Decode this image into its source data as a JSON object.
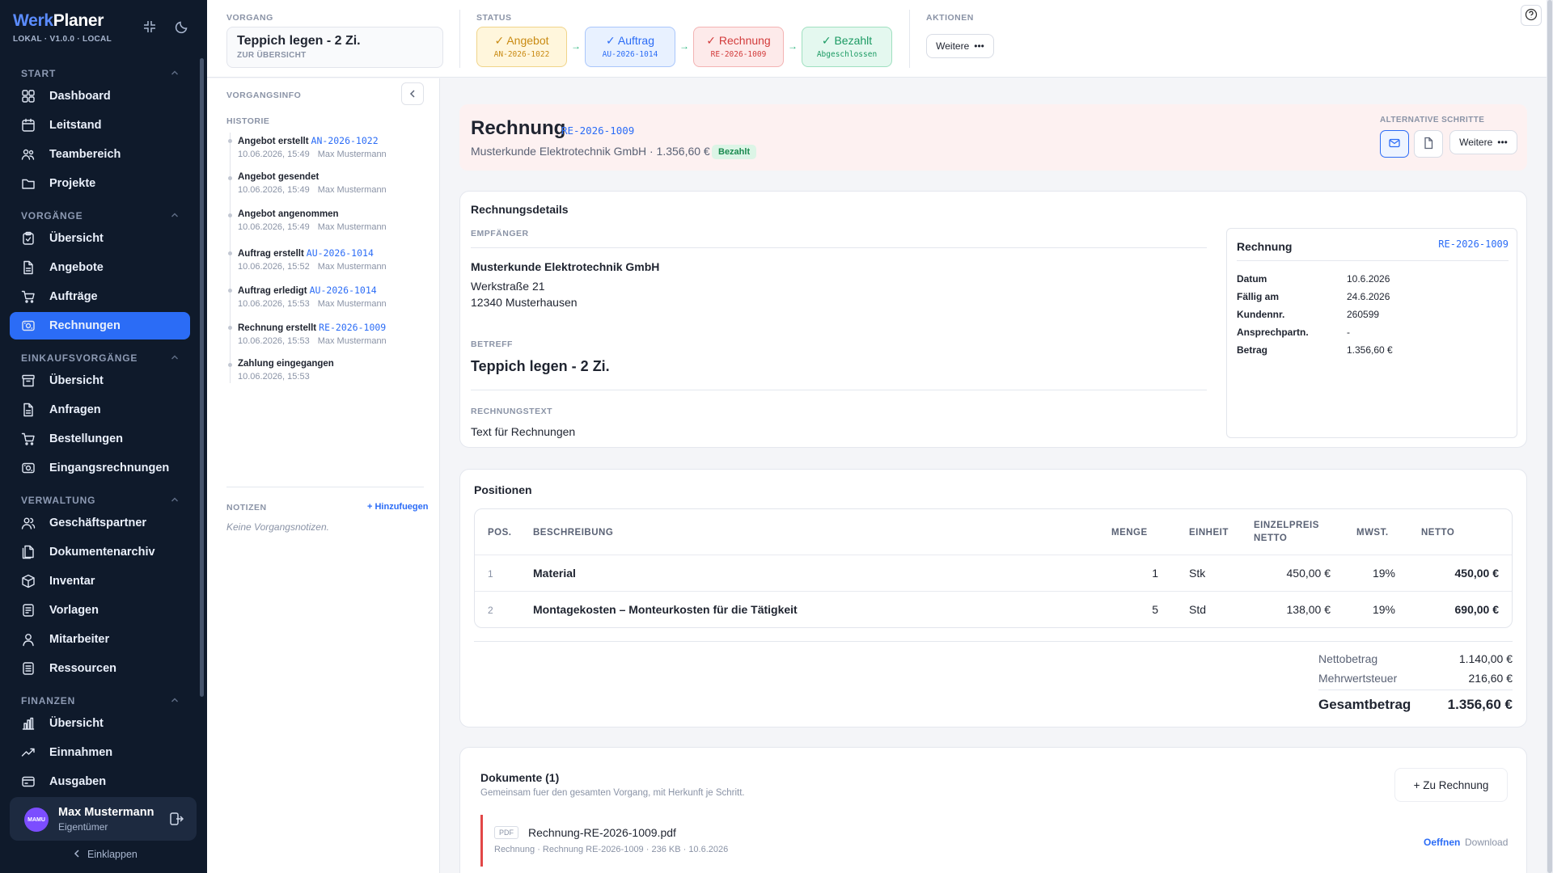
{
  "app": {
    "name_part1": "Werk",
    "name_part2": "Planer",
    "version": "LOKAL · V1.0.0 · LOCAL"
  },
  "sidebar": {
    "sections": [
      {
        "title": "START",
        "items": [
          "Dashboard",
          "Leitstand",
          "Teambereich",
          "Projekte"
        ]
      },
      {
        "title": "VORGÄNGE",
        "items": [
          "Übersicht",
          "Angebote",
          "Aufträge",
          "Rechnungen"
        ]
      },
      {
        "title": "EINKAUFSVORGÄNGE",
        "items": [
          "Übersicht",
          "Anfragen",
          "Bestellungen",
          "Eingangsrechnungen"
        ]
      },
      {
        "title": "VERWALTUNG",
        "items": [
          "Geschäftspartner",
          "Dokumentenarchiv",
          "Inventar",
          "Vorlagen",
          "Mitarbeiter",
          "Ressourcen"
        ]
      },
      {
        "title": "FINANZEN",
        "items": [
          "Übersicht",
          "Einnahmen",
          "Ausgaben"
        ]
      }
    ],
    "active_item": "Rechnungen",
    "user": {
      "initials": "MAMU",
      "name": "Max Mustermann",
      "role": "Eigentümer"
    },
    "collapse_label": "Einklappen"
  },
  "topbar": {
    "vorgang_label": "VORGANG",
    "vorgang_title": "Teppich legen - 2 Zi.",
    "vorgang_back": "ZUR ÜBERSICHT",
    "status_label": "STATUS",
    "statuses": [
      {
        "name": "Angebot",
        "code": "AN-2026-1022",
        "color": "#c98a12",
        "bg": "#fff6dc",
        "border": "#f0d48a"
      },
      {
        "name": "Auftrag",
        "code": "AU-2026-1014",
        "color": "#2b6cf6",
        "bg": "#e8f1ff",
        "border": "#a9c6fb"
      },
      {
        "name": "Rechnung",
        "code": "RE-2026-1009",
        "color": "#d23b3b",
        "bg": "#fdeaea",
        "border": "#f3b3b3"
      },
      {
        "name": "Bezahlt",
        "code": "Abgeschlossen",
        "color": "#1b9a63",
        "bg": "#e4f8ef",
        "border": "#9fe0c0"
      }
    ],
    "actions_label": "AKTIONEN",
    "actions_button": "Weitere"
  },
  "info": {
    "title": "VORGANGSINFO",
    "history_label": "HISTORIE",
    "history": [
      {
        "action": "Angebot erstellt",
        "ref": "AN-2026-1022",
        "time": "10.06.2026, 15:49",
        "user": "Max Mustermann"
      },
      {
        "action": "Angebot gesendet",
        "ref": "",
        "time": "10.06.2026, 15:49",
        "user": "Max Mustermann"
      },
      {
        "action": "Angebot angenommen",
        "ref": "",
        "time": "10.06.2026, 15:49",
        "user": "Max Mustermann"
      },
      {
        "action": "Auftrag erstellt",
        "ref": "AU-2026-1014",
        "time": "10.06.2026, 15:52",
        "user": "Max Mustermann"
      },
      {
        "action": "Auftrag erledigt",
        "ref": "AU-2026-1014",
        "time": "10.06.2026, 15:53",
        "user": "Max Mustermann"
      },
      {
        "action": "Rechnung erstellt",
        "ref": "RE-2026-1009",
        "time": "10.06.2026, 15:53",
        "user": "Max Mustermann"
      },
      {
        "action": "Zahlung eingegangen",
        "ref": "",
        "time": "10.06.2026, 15:53",
        "user": ""
      }
    ],
    "notes_label": "NOTIZEN",
    "add_note": "+ Hinzufuegen",
    "no_notes": "Keine Vorgangsnotizen."
  },
  "invoice": {
    "title": "Rechnung",
    "number": "RE-2026-1009",
    "subtitle": "Musterkunde Elektrotechnik GmbH · 1.356,60 €",
    "status_badge": "Bezahlt",
    "alt_steps_label": "ALTERNATIVE SCHRITTE",
    "alt_more": "Weitere",
    "details_title": "Rechnungsdetails",
    "recipient_label": "EMPFÄNGER",
    "recipient_name": "Musterkunde Elektrotechnik GmbH",
    "recipient_street": "Werkstraße 21",
    "recipient_city": "12340 Musterhausen",
    "subject_label": "BETREFF",
    "subject": "Teppich legen - 2 Zi.",
    "text_label": "RECHNUNGSTEXT",
    "text": "Text für Rechnungen",
    "box_title": "Rechnung",
    "box_number": "RE-2026-1009",
    "box_rows": [
      {
        "k": "Datum",
        "v": "10.6.2026"
      },
      {
        "k": "Fällig am",
        "v": "24.6.2026"
      },
      {
        "k": "Kundennr.",
        "v": "260599"
      },
      {
        "k": "Ansprechpartn.",
        "v": "-"
      },
      {
        "k": "Betrag",
        "v": "1.356,60 €"
      }
    ]
  },
  "positions": {
    "title": "Positionen",
    "headers": {
      "pos": "POS.",
      "desc": "BESCHREIBUNG",
      "qty": "MENGE",
      "unit": "EINHEIT",
      "price1": "EINZELPREIS",
      "price2": "NETTO",
      "vat": "MWST.",
      "net": "NETTO"
    },
    "rows": [
      {
        "pos": "1",
        "desc": "Material",
        "qty": "1",
        "unit": "Stk",
        "price": "450,00 €",
        "vat": "19%",
        "net": "450,00 €"
      },
      {
        "pos": "2",
        "desc": "Montagekosten – Monteurkosten für die Tätigkeit",
        "qty": "5",
        "unit": "Std",
        "price": "138,00 €",
        "vat": "19%",
        "net": "690,00 €"
      }
    ],
    "totals": [
      {
        "k": "Nettobetrag",
        "v": "1.140,00 €"
      },
      {
        "k": "Mehrwertsteuer",
        "v": "216,60 €"
      }
    ],
    "grand_label": "Gesamtbetrag",
    "grand_value": "1.356,60 €"
  },
  "documents": {
    "title": "Dokumente (1)",
    "subtitle": "Gemeinsam fuer den gesamten Vorgang, mit Herkunft je Schritt.",
    "add_button": "+ Zu Rechnung",
    "items": [
      {
        "type": "PDF",
        "name": "Rechnung-RE-2026-1009.pdf",
        "meta": "Rechnung · Rechnung RE-2026-1009 · 236 KB · 10.6.2026",
        "open": "Oeffnen",
        "download": "Download"
      }
    ]
  }
}
